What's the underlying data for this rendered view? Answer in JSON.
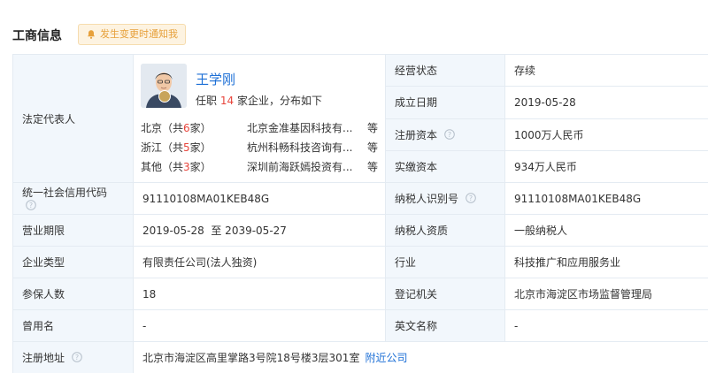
{
  "header": {
    "title": "工商信息",
    "notify_label": "发生变更时通知我"
  },
  "legal_rep": {
    "label": "法定代表人",
    "name": "王学刚",
    "summary_prefix": "任职",
    "summary_count": "14",
    "summary_suffix": "家企业，分布如下",
    "regions": [
      {
        "name_prefix": "北京（共",
        "count": "6",
        "name_suffix": "家）",
        "company": "北京金准基因科技有...",
        "more": "等"
      },
      {
        "name_prefix": "浙江（共",
        "count": "5",
        "name_suffix": "家）",
        "company": "杭州科畅科技咨询有...",
        "more": "等"
      },
      {
        "name_prefix": "其他（共",
        "count": "3",
        "name_suffix": "家）",
        "company": "深圳前海跃嫣投资有...",
        "more": "等"
      }
    ]
  },
  "right_top": [
    {
      "label": "经营状态",
      "value": "存续"
    },
    {
      "label": "成立日期",
      "value": "2019-05-28"
    },
    {
      "label": "注册资本",
      "value": "1000万人民币",
      "help": true
    },
    {
      "label": "实缴资本",
      "value": "934万人民币"
    }
  ],
  "rows": {
    "credit_code": {
      "label": "统一社会信用代码",
      "value": "91110108MA01KEB48G"
    },
    "taxpayer_id": {
      "label": "纳税人识别号",
      "value": "91110108MA01KEB48G"
    },
    "term": {
      "label": "营业期限",
      "value": "2019-05-28  至 2039-05-27"
    },
    "taxpayer_qual": {
      "label": "纳税人资质",
      "value": "一般纳税人"
    },
    "company_type": {
      "label": "企业类型",
      "value": "有限责任公司(法人独资)"
    },
    "industry": {
      "label": "行业",
      "value": "科技推广和应用服务业"
    },
    "insured": {
      "label": "参保人数",
      "value": "18"
    },
    "registry": {
      "label": "登记机关",
      "value": "北京市海淀区市场监督管理局"
    },
    "former_name": {
      "label": "曾用名",
      "value": "-"
    },
    "english_name": {
      "label": "英文名称",
      "value": "-"
    },
    "address": {
      "label": "注册地址",
      "value": "北京市海淀区高里掌路3号院18号楼3层301室",
      "link": "附近公司"
    }
  },
  "colors": {
    "label_bg": "#f2f7fc",
    "border": "#e4ebf2",
    "link": "#1c6fd6",
    "highlight": "#e8453c",
    "notify_bg": "#fdf3e1",
    "notify_text": "#e7a13c"
  }
}
